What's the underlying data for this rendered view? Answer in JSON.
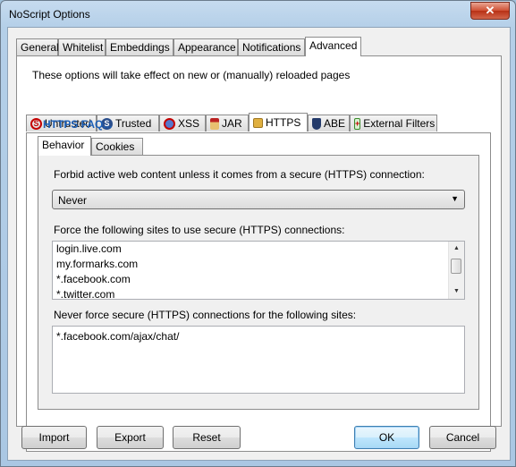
{
  "window": {
    "title": "NoScript Options",
    "close_glyph": "✕"
  },
  "tabs_main": [
    {
      "label": "General"
    },
    {
      "label": "Whitelist"
    },
    {
      "label": "Embeddings"
    },
    {
      "label": "Appearance"
    },
    {
      "label": "Notifications"
    },
    {
      "label": "Advanced"
    }
  ],
  "advanced": {
    "note": "These options will take effect on new or (manually) reloaded pages",
    "tabs": [
      {
        "label": "Untrusted",
        "icon": "untrusted-icon"
      },
      {
        "label": "Trusted",
        "icon": "trusted-icon"
      },
      {
        "label": "XSS",
        "icon": "xss-icon"
      },
      {
        "label": "JAR",
        "icon": "jar-icon"
      },
      {
        "label": "HTTPS",
        "icon": "lock-icon"
      },
      {
        "label": "ABE",
        "icon": "abe-icon"
      },
      {
        "label": "External Filters",
        "icon": "external-filters-icon"
      }
    ]
  },
  "https": {
    "faq_link": "HTTPS FAQ...",
    "subtabs": [
      {
        "label": "Behavior"
      },
      {
        "label": "Cookies"
      }
    ],
    "forbid_label": "Forbid active web content unless it comes from a secure (HTTPS) connection:",
    "forbid_value": "Never",
    "force_label": "Force the following sites to use secure (HTTPS) connections:",
    "force_sites": [
      "login.live.com",
      "my.formarks.com",
      "*.facebook.com",
      "*.twitter.com"
    ],
    "never_label": "Never force secure (HTTPS) connections for the following sites:",
    "never_sites": [
      "*.facebook.com/ajax/chat/"
    ]
  },
  "buttons": {
    "import": "Import",
    "export": "Export",
    "reset": "Reset",
    "ok": "OK",
    "cancel": "Cancel"
  },
  "colors": {
    "link": "#1c5fb7",
    "close_button": "#cf4f33",
    "frame": "#b4cfe8"
  }
}
